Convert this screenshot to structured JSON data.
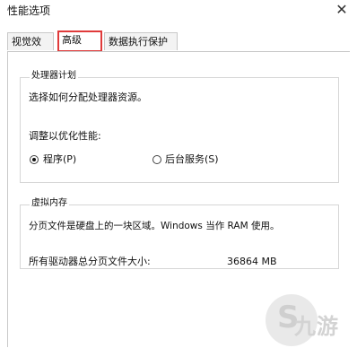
{
  "window": {
    "title": "性能选项",
    "close_glyph": "✕"
  },
  "tabs": [
    {
      "label": "视觉效果"
    },
    {
      "label": "高级"
    },
    {
      "label": "数据执行保护"
    }
  ],
  "processor": {
    "group_label": "处理器计划",
    "description": "选择如何分配处理器资源。",
    "adjust_label": "调整以优化性能:",
    "options": [
      {
        "label": "程序(P)",
        "selected": true
      },
      {
        "label": "后台服务(S)",
        "selected": false
      }
    ]
  },
  "virtual_memory": {
    "group_label": "虚拟内存",
    "description": "分页文件是硬盘上的一块区域。Windows 当作 RAM 使用。",
    "total_label": "所有驱动器总分页文件大小:",
    "total_value": "36864 MB"
  },
  "watermark": {
    "text": "九游"
  },
  "colors": {
    "highlight": "#e03a3a"
  }
}
